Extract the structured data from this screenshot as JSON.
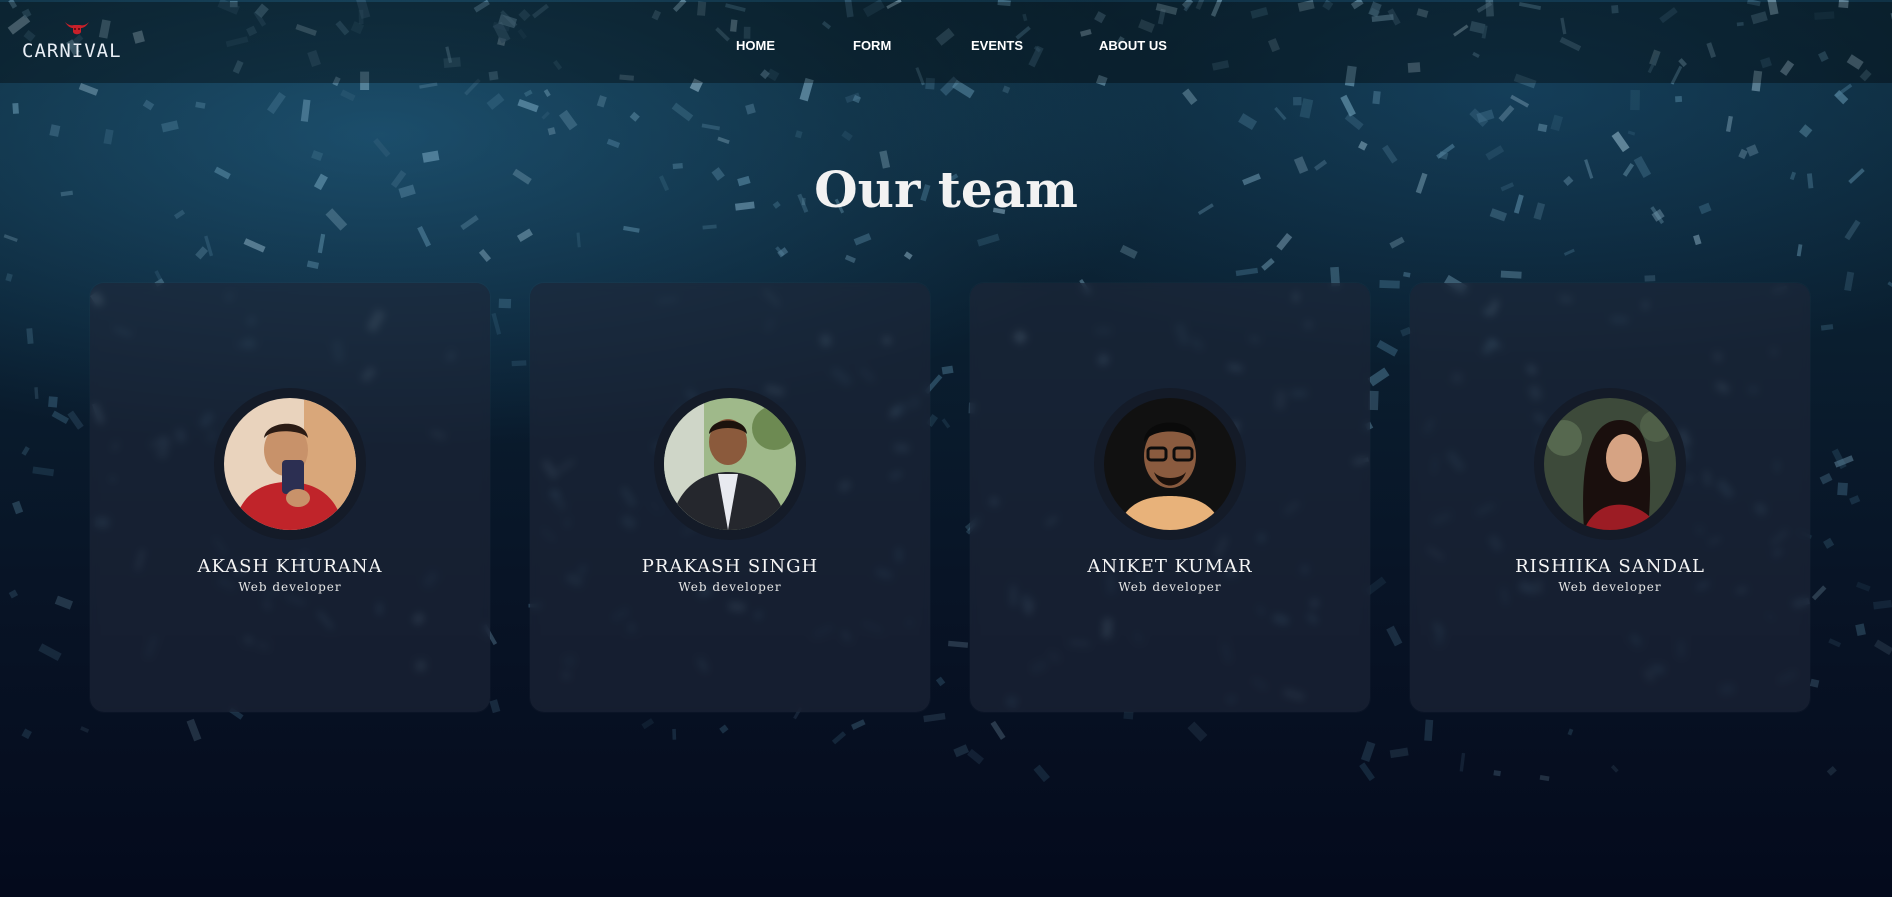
{
  "brand": {
    "name": "CARNIVAL",
    "icon": "bull-icon",
    "accent_color": "#c8202a"
  },
  "nav": {
    "items": [
      {
        "label": "HOME"
      },
      {
        "label": "FORM"
      },
      {
        "label": "EVENTS"
      },
      {
        "label": "ABOUT US"
      }
    ]
  },
  "page": {
    "title": "Our team"
  },
  "team": [
    {
      "name": "AKASH KHURANA",
      "role": "Web developer",
      "avatar": "portrait-photo"
    },
    {
      "name": "PRAKASH SINGH",
      "role": "Web developer",
      "avatar": "portrait-photo"
    },
    {
      "name": "ANIKET KUMAR",
      "role": "Web developer",
      "avatar": "portrait-photo"
    },
    {
      "name": "RISHIIKA SANDAL",
      "role": "Web developer",
      "avatar": "portrait-photo"
    }
  ],
  "colors": {
    "background": "#081426",
    "card": "#1e2638",
    "text": "#f5f5f5"
  }
}
